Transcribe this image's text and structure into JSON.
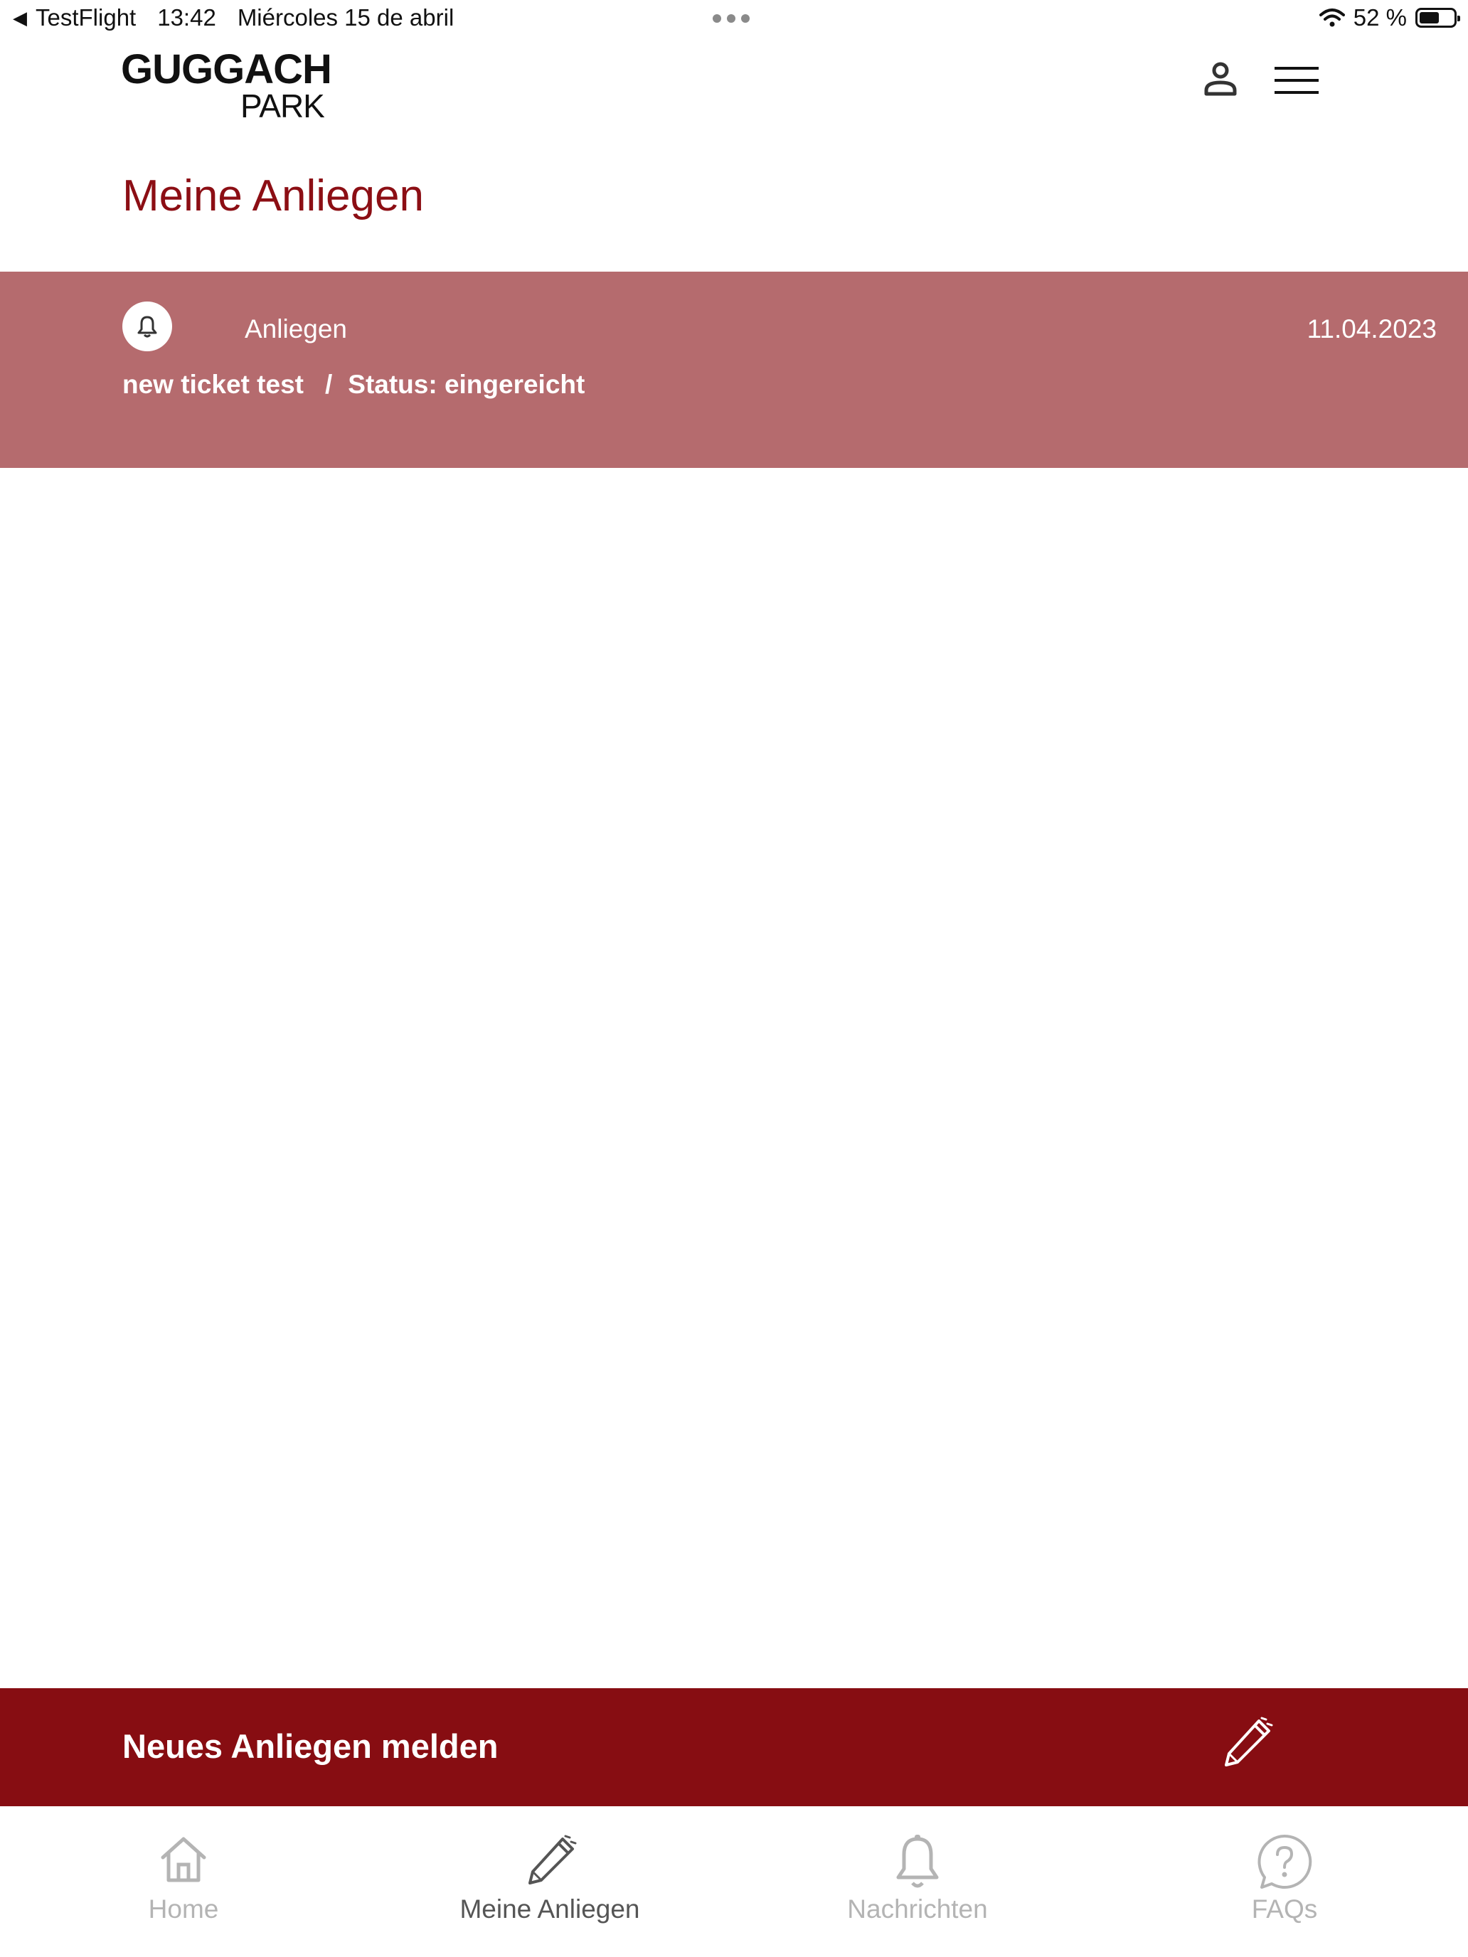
{
  "status_bar": {
    "back_app": "TestFlight",
    "time": "13:42",
    "date": "Miércoles 15 de abril",
    "battery": "52 %",
    "battery_level": 0.52
  },
  "header": {
    "logo_line1": "GUGGACH",
    "logo_line2": "PARK",
    "user_icon": "user-icon",
    "menu_icon": "hamburger-menu-icon"
  },
  "page": {
    "title": "Meine Anliegen"
  },
  "tickets": [
    {
      "type": "Anliegen",
      "date": "11.04.2023",
      "subject": "new ticket test",
      "separator": "/",
      "status": "Status: eingereicht",
      "icon": "bell-icon"
    }
  ],
  "action_bar": {
    "label": "Neues Anliegen melden",
    "icon": "pencil-icon"
  },
  "tab_bar": {
    "tabs": [
      {
        "label": "Home",
        "icon": "home-icon",
        "active": false
      },
      {
        "label": "Meine Anliegen",
        "icon": "pencil-icon",
        "active": true
      },
      {
        "label": "Nachrichten",
        "icon": "bell-icon",
        "active": false
      },
      {
        "label": "FAQs",
        "icon": "question-bubble-icon",
        "active": false
      }
    ]
  },
  "colors": {
    "brand_red": "#8c0e14",
    "card_background": "#b56b6e",
    "action_bar_background": "#870d12",
    "tab_inactive": "#b4b4b4",
    "tab_active": "#555555"
  }
}
